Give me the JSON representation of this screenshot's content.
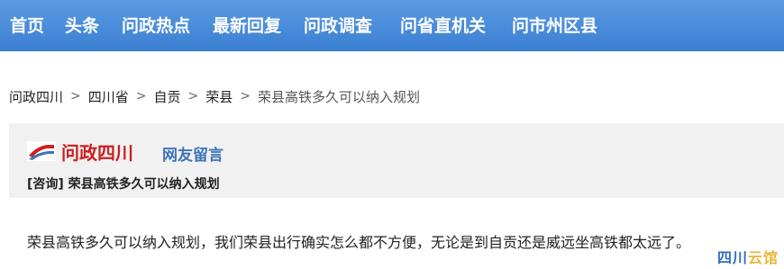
{
  "topnav": {
    "items": [
      "首页",
      "头条",
      "问政热点",
      "最新回复",
      "问政调查",
      "问省直机关",
      "问市州区县"
    ]
  },
  "breadcrumb": {
    "items": [
      "问政四川",
      "四川省",
      "自贡",
      "荣县"
    ],
    "current": "荣县高铁多久可以纳入规划",
    "separator": ">"
  },
  "card": {
    "brand_name": "问政四川",
    "brand_sub": "网友留言",
    "post_title": "[咨询] 荣县高铁多久可以纳入规划"
  },
  "post": {
    "body": "荣县高铁多久可以纳入规划，我们荣县出行确实怎么都不方便，无论是到自贡还是威远坐高铁都太远了。"
  },
  "watermark": {
    "part1": "四川",
    "part2": "云馆"
  },
  "colors": {
    "nav_bg": "#3b7fd2",
    "brand_red": "#cc1f1f",
    "brand_blue": "#3d74b8",
    "card_bg": "#f1f1f1"
  }
}
